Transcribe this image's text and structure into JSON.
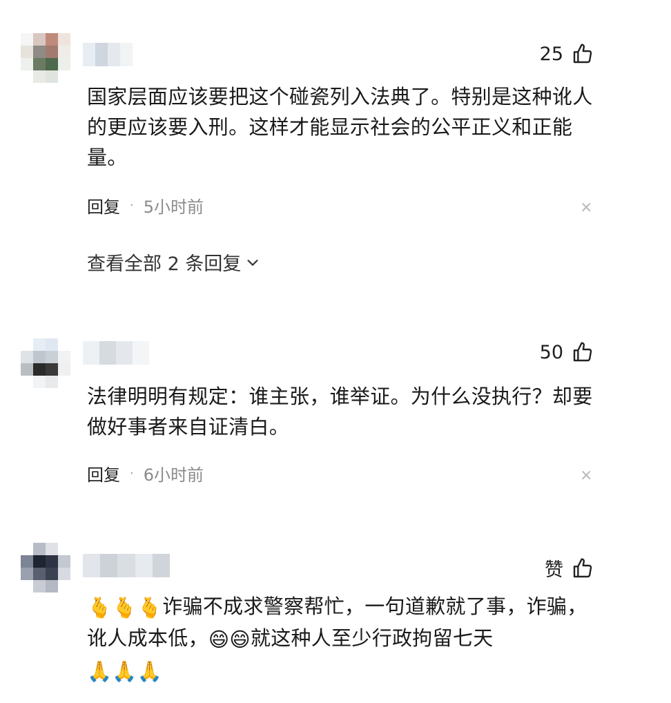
{
  "comments": [
    {
      "avatar_colors": [
        "#f5f5f5",
        "#d8c7c0",
        "#c08a7a",
        "#efe3dd",
        "#e6e2dc",
        "#8f8b86",
        "#a27a6e",
        "#f0ece8",
        "#eef0ed",
        "#6b7a63",
        "#4e6a4c",
        "#ecefea",
        "#ffffff",
        "#e8eae6",
        "#dfe5de",
        "#ffffff"
      ],
      "username_blocks": [
        "#e8edf3",
        "#cfd6df",
        "#e5e9ee",
        "#f1f3f5"
      ],
      "likes": "25",
      "text": "国家层面应该要把这个碰瓷列入法典了。特别是这种讹人的更应该要入刑。这样才能显示社会的公平正义和正能量。",
      "reply_label": "回复",
      "separator": "·",
      "time": "5小时前",
      "close": "×",
      "view_all": "查看全部 2 条回复"
    },
    {
      "avatar_colors": [
        "#ffffff",
        "#e6eef5",
        "#dfe8f1",
        "#ffffff",
        "#dfe3e7",
        "#bfc6cd",
        "#c9d0d6",
        "#f0f2f4",
        "#b9bec3",
        "#2b2b2b",
        "#3a3a3a",
        "#eef0f1",
        "#ffffff",
        "#f2f3f4",
        "#e8eaec",
        "#ffffff"
      ],
      "username_blocks": [
        "#eef1f4",
        "#d6dbe0",
        "#e4e8ec",
        "#f3f5f7"
      ],
      "likes": "50",
      "text": "法律明明有规定：谁主张，谁举证。为什么没执行？却要做好事者来自证清白。",
      "reply_label": "回复",
      "separator": "·",
      "time": "6小时前",
      "close": "×"
    },
    {
      "avatar_colors": [
        "#ffffff",
        "#b8bcc7",
        "#dfe1e6",
        "#ffffff",
        "#7c8496",
        "#1f2433",
        "#2e3444",
        "#c4c8d0",
        "#9aa0ae",
        "#5a5f70",
        "#3d4253",
        "#d7dae0",
        "#ffffff",
        "#c8ccd4",
        "#b3b8c2",
        "#ffffff"
      ],
      "username_blocks": [
        "#e2e6ea",
        "#ccd2d8",
        "#d9dee3",
        "#e7eaee",
        "#d0d5db"
      ],
      "likes": "赞",
      "text_emoji_hearts": "🫰🫰🫰",
      "text_part1": "诈骗不成求警察帮忙，一句道歉就了事，诈骗，讹人成本低，",
      "text_emoji_laugh": "😄😄",
      "text_part2": "就这种人至少行政拘留七天",
      "text_emoji_pray": "🙏🙏🙏"
    }
  ]
}
